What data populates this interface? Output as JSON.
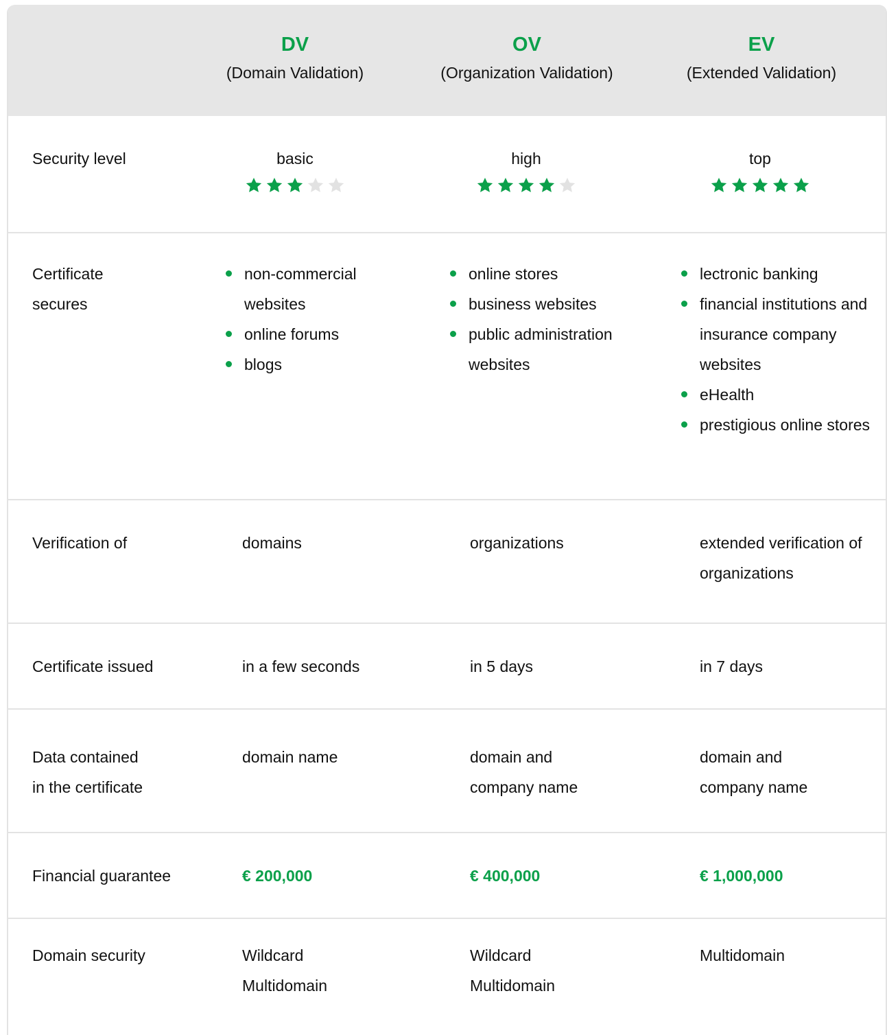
{
  "header": {
    "columns": [
      {
        "abbr": "DV",
        "full": "(Domain Validation)"
      },
      {
        "abbr": "OV",
        "full": "(Organization Validation)"
      },
      {
        "abbr": "EV",
        "full": "(Extended Validation)"
      }
    ]
  },
  "rows": {
    "security_level": {
      "label": "Security level",
      "values": [
        {
          "text": "basic",
          "stars": 3,
          "max": 5
        },
        {
          "text": "high",
          "stars": 4,
          "max": 5
        },
        {
          "text": "top",
          "stars": 5,
          "max": 5
        }
      ]
    },
    "certificate_secures": {
      "label_lines": [
        "Certificate",
        "secures"
      ],
      "values": [
        [
          "non-commercial websites",
          "online forums",
          "blogs"
        ],
        [
          "online stores",
          "business websites",
          "public administration websites"
        ],
        [
          "lectronic banking",
          "financial institutions and insurance company websites",
          "eHealth",
          "prestigious online stores"
        ]
      ]
    },
    "verification_of": {
      "label": "Verification of",
      "values": [
        "domains",
        "organizations",
        "extended verification of organizations"
      ]
    },
    "certificate_issued": {
      "label": "Certificate issued",
      "values": [
        "in a few seconds",
        "in 5 days",
        "in 7 days"
      ]
    },
    "data_contained": {
      "label_lines": [
        "Data contained",
        "in the certificate"
      ],
      "values": [
        "domain name",
        "domain and company name",
        "domain and company name"
      ]
    },
    "financial_guarantee": {
      "label": "Financial guarantee",
      "values": [
        "€ 200,000",
        "€ 400,000",
        "€ 1,000,000"
      ]
    },
    "domain_security": {
      "label": "Domain security",
      "values": [
        [
          "Wildcard",
          "Multidomain"
        ],
        [
          "Wildcard",
          "Multidomain"
        ],
        [
          "Multidomain"
        ]
      ]
    }
  },
  "colors": {
    "accent": "#0ba04a",
    "star_empty": "#e2e2e2",
    "header_bg": "#e6e6e6"
  }
}
